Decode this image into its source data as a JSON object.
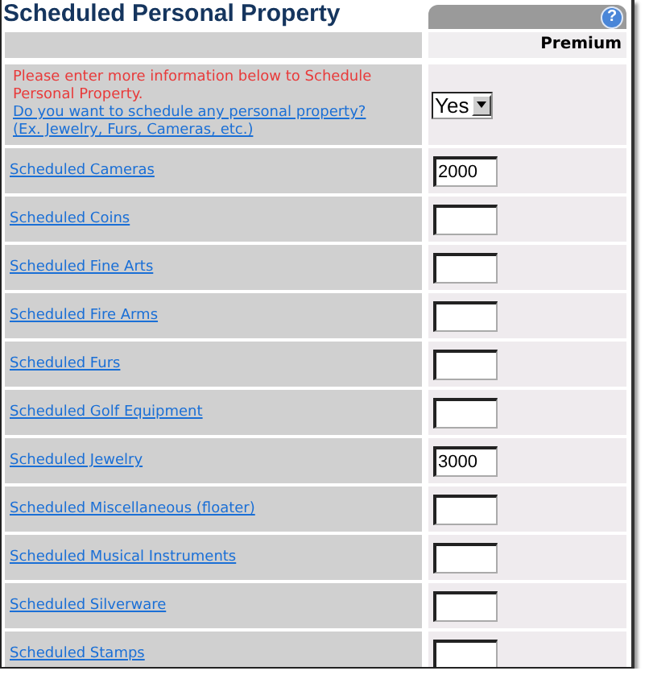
{
  "title": "Scheduled Personal Property",
  "help_icon": "?",
  "header": {
    "column_2": "Premium"
  },
  "question": {
    "notice": "Please enter more information below to Schedule Personal Property.",
    "link": "Do you want to schedule any personal property? (Ex. Jewelry, Furs, Cameras, etc.)",
    "select_value": "Yes"
  },
  "rows": [
    {
      "label": "Scheduled Cameras",
      "value": "2000"
    },
    {
      "label": "Scheduled Coins"
    },
    {
      "label": "Scheduled Fine Arts"
    },
    {
      "label": "Scheduled Fire Arms"
    },
    {
      "label": "Scheduled Furs"
    },
    {
      "label": "Scheduled Golf Equipment"
    },
    {
      "label": "Scheduled Jewelry",
      "value": "3000"
    },
    {
      "label": "Scheduled Miscellaneous (floater)"
    },
    {
      "label": "Scheduled Musical Instruments"
    },
    {
      "label": "Scheduled Silverware"
    },
    {
      "label": "Scheduled Stamps"
    }
  ]
}
